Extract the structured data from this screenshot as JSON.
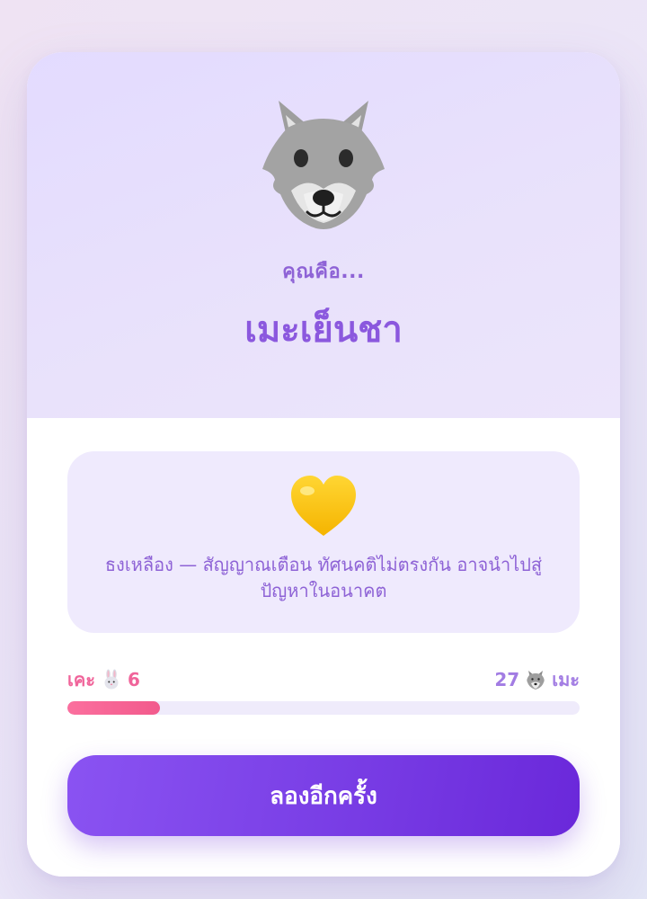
{
  "result": {
    "icon": "wolf-icon",
    "subtitle": "คุณคือ...",
    "title": "เมะเย็นชา"
  },
  "flag": {
    "icon": "yellow-heart-icon",
    "text": "ธงเหลือง — สัญญาณเตือน ทัศนคติไม่ตรงกัน อาจนำไปสู่ปัญหาในอนาคต"
  },
  "score": {
    "left_label": "เคะ",
    "left_icon": "rabbit-icon",
    "left_value": "6",
    "right_value": "27",
    "right_icon": "wolf-icon",
    "right_label": "เมะ",
    "fill_fraction": 0.18
  },
  "button": {
    "label": "ลองอีกครั้ง"
  },
  "colors": {
    "accent": "#8b58de",
    "button_start": "#8a53f2",
    "button_end": "#6a28da",
    "uke_pink": "#f0649a",
    "seme_purple": "#a27ce3",
    "hero_bg": "#e5dcfd",
    "flag_box_bg": "#efeafd"
  }
}
